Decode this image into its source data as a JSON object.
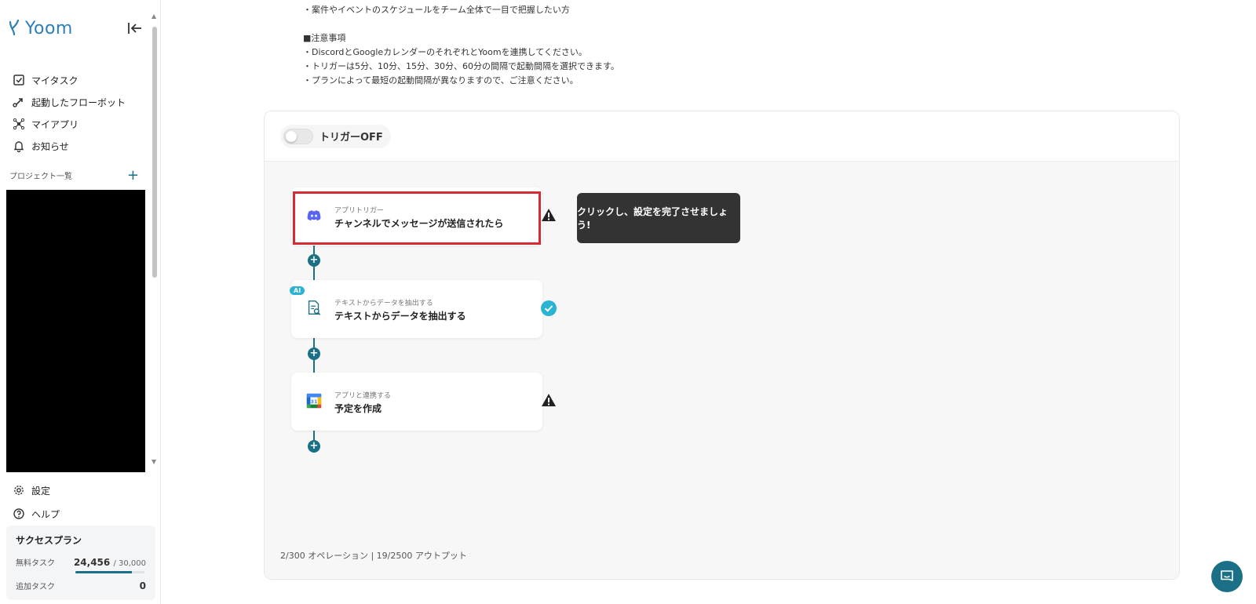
{
  "sidebar": {
    "logo_text": "Yoom",
    "nav": [
      {
        "label": "マイタスク",
        "icon": "checkbox-icon"
      },
      {
        "label": "起動したフローボット",
        "icon": "flow-arrow-icon"
      },
      {
        "label": "マイアプリ",
        "icon": "app-network-icon"
      },
      {
        "label": "お知らせ",
        "icon": "bell-icon"
      }
    ],
    "project_heading": "プロジェクト一覧",
    "project_add": "+",
    "bottom_nav": [
      {
        "label": "設定",
        "icon": "gear-icon"
      },
      {
        "label": "ヘルプ",
        "icon": "help-icon"
      }
    ],
    "plan": {
      "title": "サクセスプラン",
      "free_task_label": "無料タスク",
      "free_task_used": "24,456",
      "free_task_max": "/ 30,000",
      "free_task_progress": 0.8152,
      "extra_task_label": "追加タスク",
      "extra_task_value": "0"
    }
  },
  "description": {
    "lines": [
      "・案件やイベントのスケジュールをチーム全体で一目で把握したい方",
      "",
      "■注意事項",
      "・DiscordとGoogleカレンダーのそれぞれとYoomを連携してください。",
      "・トリガーは5分、10分、15分、30分、60分の間隔で起動間隔を選択できます。",
      "・プランによって最短の起動間隔が異なりますので、ご注意ください。"
    ]
  },
  "flow": {
    "trigger_toggle_label": "トリガーOFF",
    "steps": [
      {
        "sub": "アプリトリガー",
        "title": "チャンネルでメッセージが送信されたら",
        "icon": "discord-icon",
        "status": "warning-icon"
      },
      {
        "sub": "テキストからデータを抽出する",
        "title": "テキストからデータを抽出する",
        "icon": "document-search-icon",
        "status": "check-icon",
        "badge": "AI"
      },
      {
        "sub": "アプリと連携する",
        "title": "予定を作成",
        "icon": "google-calendar-icon",
        "status": "warning-icon"
      }
    ],
    "tooltip": "クリックし、設定を完了させましょう!",
    "plus": "+",
    "usage": "2/300 オペレーション | 19/2500 アウトプット"
  },
  "colors": {
    "accent": "#1b6f86",
    "highlight": "#d62b33",
    "check": "#2bb3d4",
    "tooltip_bg": "#333333"
  }
}
